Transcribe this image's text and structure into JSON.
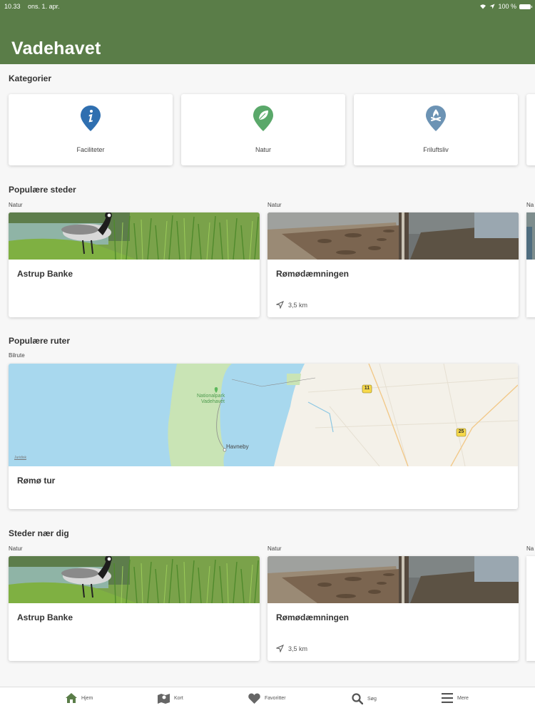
{
  "status": {
    "time": "10.33",
    "date": "ons. 1. apr.",
    "battery": "100 %"
  },
  "app": {
    "title": "Vadehavet",
    "header_color": "#5a7d48"
  },
  "sections": {
    "categories": "Kategorier",
    "popular_places": "Populære steder",
    "popular_routes": "Populære ruter",
    "nearby": "Steder nær dig"
  },
  "categories": [
    {
      "label": "Faciliteter",
      "icon": "info-pin-icon",
      "color": "#2f6fb0"
    },
    {
      "label": "Natur",
      "icon": "leaf-pin-icon",
      "color": "#5aa86a"
    },
    {
      "label": "Friluftsliv",
      "icon": "campfire-pin-icon",
      "color": "#6c93b4"
    }
  ],
  "popular_places": [
    {
      "tag": "Natur",
      "name": "Astrup Banke",
      "distance": ""
    },
    {
      "tag": "Natur",
      "name": "Rømødæmningen",
      "distance": "3,5 km"
    },
    {
      "tag": "Na"
    }
  ],
  "popular_routes": [
    {
      "tag": "Bilrute",
      "name": "Rømø tur",
      "map_labels": {
        "park": "Nationalpark",
        "park2": "Vadehavet",
        "town": "Havneby",
        "road1": "11",
        "road2": "25",
        "legal": "Juridisk"
      }
    }
  ],
  "nearby": [
    {
      "tag": "Natur",
      "name": "Astrup Banke",
      "distance": ""
    },
    {
      "tag": "Natur",
      "name": "Rømødæmningen",
      "distance": "3,5 km"
    },
    {
      "tag": "Na"
    }
  ],
  "tabs": [
    {
      "label": "Hjem",
      "icon": "home-icon",
      "active": true
    },
    {
      "label": "Kort",
      "icon": "map-icon"
    },
    {
      "label": "Favoritter",
      "icon": "heart-icon"
    },
    {
      "label": "Søg",
      "icon": "search-icon"
    },
    {
      "label": "Mere",
      "icon": "menu-icon"
    }
  ]
}
